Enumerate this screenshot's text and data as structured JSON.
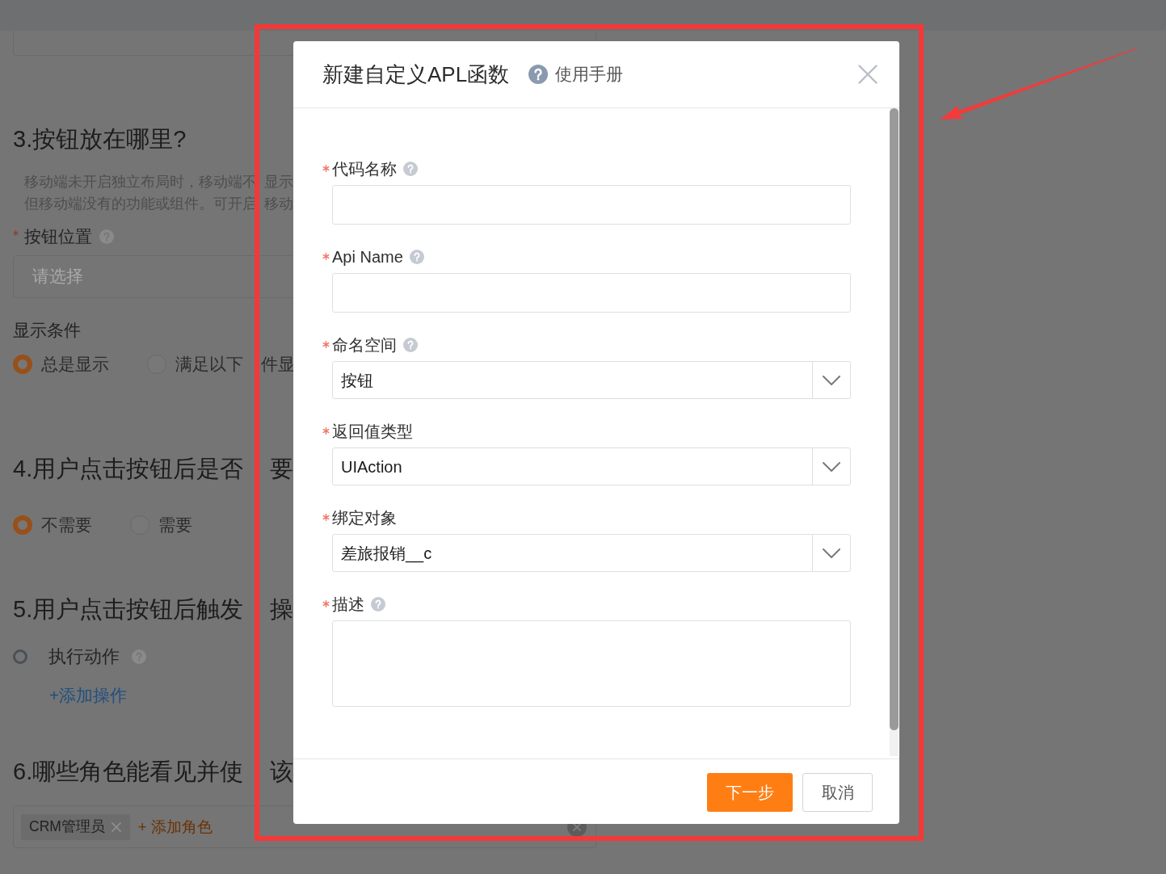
{
  "background_form": {
    "sections": [
      {
        "kind": "location",
        "heading": [
          "3.按钮放在哪里?"
        ],
        "note_lines": [
          [
            "移动端未开启独立布局时，移动端不",
            "显示"
          ],
          [
            "但移动端没有的功能或组件。可开启",
            "移动"
          ]
        ],
        "field": {
          "label": "按钮位置",
          "required": true,
          "help": true,
          "placeholder": "请选择"
        },
        "condition": {
          "label": "显示条件",
          "options": [
            {
              "label": [
                "总是显示"
              ],
              "selected": true
            },
            {
              "label": [
                "满足以下",
                "件显"
              ],
              "selected": false
            }
          ]
        }
      },
      {
        "kind": "choice",
        "heading": [
          "4.用户点击按钮后是否",
          "要"
        ],
        "options": [
          {
            "label": "不需要",
            "selected": true
          },
          {
            "label": "需要",
            "selected": false
          }
        ]
      },
      {
        "kind": "actions",
        "heading": [
          "5.用户点击按钮后触发",
          "操"
        ],
        "action": {
          "label": "执行动作",
          "help": true
        },
        "add_link": "+添加操作"
      },
      {
        "kind": "roles",
        "heading": [
          "6.哪些角色能看见并使",
          "该"
        ],
        "roles": [
          {
            "label": "CRM管理员"
          }
        ],
        "add_link": "+ 添加角色"
      }
    ]
  },
  "dialog": {
    "title": "新建自定义APL函数",
    "help_link": "使用手册",
    "fields": [
      {
        "kind": "input",
        "label": "代码名称",
        "required": true,
        "help": true
      },
      {
        "kind": "input",
        "label": "Api Name",
        "required": true,
        "help": true
      },
      {
        "kind": "select",
        "label": "命名空间",
        "required": true,
        "help": true,
        "value": "按钮"
      },
      {
        "kind": "select",
        "label": "返回值类型",
        "required": true,
        "help": false,
        "value": "UIAction"
      },
      {
        "kind": "select",
        "label": "绑定对象",
        "required": true,
        "help": false,
        "value": "差旅报销__c"
      },
      {
        "kind": "textarea",
        "label": "描述",
        "required": true,
        "help": true
      }
    ],
    "buttons": [
      {
        "kind": "primary",
        "label": "下一步"
      },
      {
        "kind": "default",
        "label": "取消"
      }
    ]
  }
}
